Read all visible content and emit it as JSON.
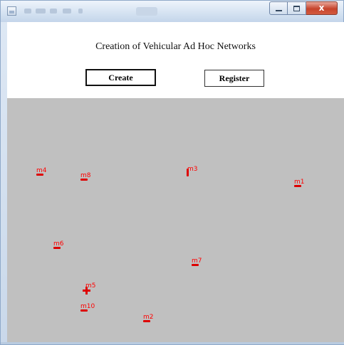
{
  "window": {
    "title": "",
    "controls": {
      "minimize_icon": "minimize-icon",
      "maximize_icon": "maximize-icon",
      "close_icon": "close-icon",
      "close_glyph": "x"
    }
  },
  "header": {
    "title": "Creation of Vehicular Ad Hoc Networks",
    "create_label": "Create",
    "register_label": "Register"
  },
  "canvas": {
    "background": "#c0c0c0",
    "node_color": "#ff0000",
    "nodes": [
      {
        "id": "m1",
        "label": "m1"
      },
      {
        "id": "m2",
        "label": "m2"
      },
      {
        "id": "m3",
        "label": "m3"
      },
      {
        "id": "m4",
        "label": "m4"
      },
      {
        "id": "m5",
        "label": "m5"
      },
      {
        "id": "m6",
        "label": "m6"
      },
      {
        "id": "m7",
        "label": "m7"
      },
      {
        "id": "m8",
        "label": "m8"
      },
      {
        "id": "m10",
        "label": "m10"
      }
    ]
  }
}
